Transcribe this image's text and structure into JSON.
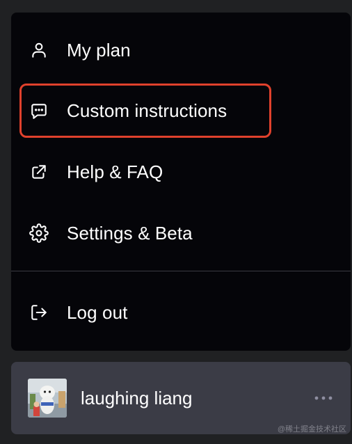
{
  "menu": {
    "items": [
      {
        "label": "My plan",
        "icon": "user-icon"
      },
      {
        "label": "Custom instructions",
        "icon": "message-dots-icon",
        "highlighted": true
      },
      {
        "label": "Help & FAQ",
        "icon": "external-link-icon"
      },
      {
        "label": "Settings & Beta",
        "icon": "gear-icon"
      }
    ],
    "logout": {
      "label": "Log out",
      "icon": "logout-icon"
    }
  },
  "user": {
    "name": "laughing liang",
    "more_icon": "ellipsis-icon"
  },
  "watermark": "@稀土掘金技术社区",
  "colors": {
    "page_background": "#202123",
    "menu_background": "#050509",
    "user_bar_background": "#3b3c46",
    "highlight_border": "#e0412c",
    "text": "#ffffff"
  }
}
